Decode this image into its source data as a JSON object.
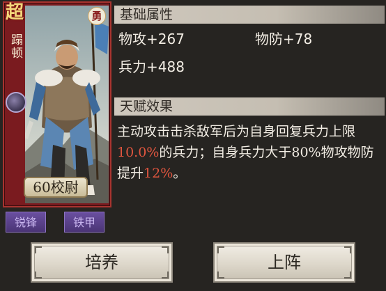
{
  "card": {
    "rarity": "超",
    "name": "蹋顿",
    "trait": "勇",
    "level_label": "60校尉"
  },
  "skills": [
    "锐锋",
    "铁甲"
  ],
  "attributes": {
    "header": "基础属性",
    "stats": [
      {
        "label": "物攻",
        "value": "+267"
      },
      {
        "label": "物防",
        "value": "+78"
      },
      {
        "label": "兵力",
        "value": "+488"
      }
    ]
  },
  "talent": {
    "header": "天赋效果",
    "text_1": "主动攻击击杀敌军后为自身回复兵力上限",
    "highlight_1": "10.0%",
    "text_2": "的兵力；自身兵力大于80%物攻物防提升",
    "highlight_2": "12%",
    "text_3": "。"
  },
  "buttons": {
    "train": "培养",
    "deploy": "上阵"
  },
  "colors": {
    "highlight": "#e2563f",
    "card_frame": "#7a1b1f",
    "skill_tag": "#6a4fa0"
  }
}
